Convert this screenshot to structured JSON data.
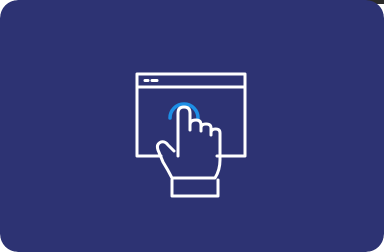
{
  "card": {
    "background_color": "#2d3373",
    "line_color": "#ffffff",
    "accent_color": "#1d8fe6"
  },
  "icons": {
    "main": "browser-window-touch-icon",
    "window": "browser-window-icon",
    "hand": "pointing-hand-icon",
    "tap": "tap-ripple-icon"
  }
}
